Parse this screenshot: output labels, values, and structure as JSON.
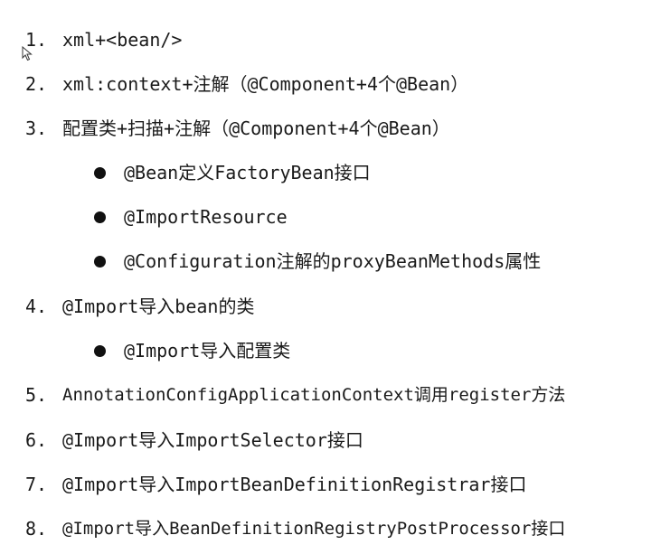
{
  "items": [
    {
      "num": "1.",
      "text": "xml+<bean/>"
    },
    {
      "num": "2.",
      "text": "xml:context+注解（@Component+4个@Bean）"
    },
    {
      "num": "3.",
      "text": "配置类+扫描+注解（@Component+4个@Bean）"
    },
    {
      "num": "4.",
      "text": "@Import导入bean的类"
    },
    {
      "num": "5.",
      "text": "AnnotationConfigApplicationContext调用register方法"
    },
    {
      "num": "6.",
      "text": "@Import导入ImportSelector接口"
    },
    {
      "num": "7.",
      "text": "@Import导入ImportBeanDefinitionRegistrar接口"
    },
    {
      "num": "8.",
      "text": "@Import导入BeanDefinitionRegistryPostProcessor接口"
    }
  ],
  "item3_bullets": [
    "@Bean定义FactoryBean接口",
    "@ImportResource",
    "@Configuration注解的proxyBeanMethods属性"
  ],
  "item4_bullets": [
    "@Import导入配置类"
  ],
  "cursor_icon": "mouse-pointer-icon",
  "colors": {
    "text": "#1a1a1a",
    "background": "#ffffff"
  }
}
